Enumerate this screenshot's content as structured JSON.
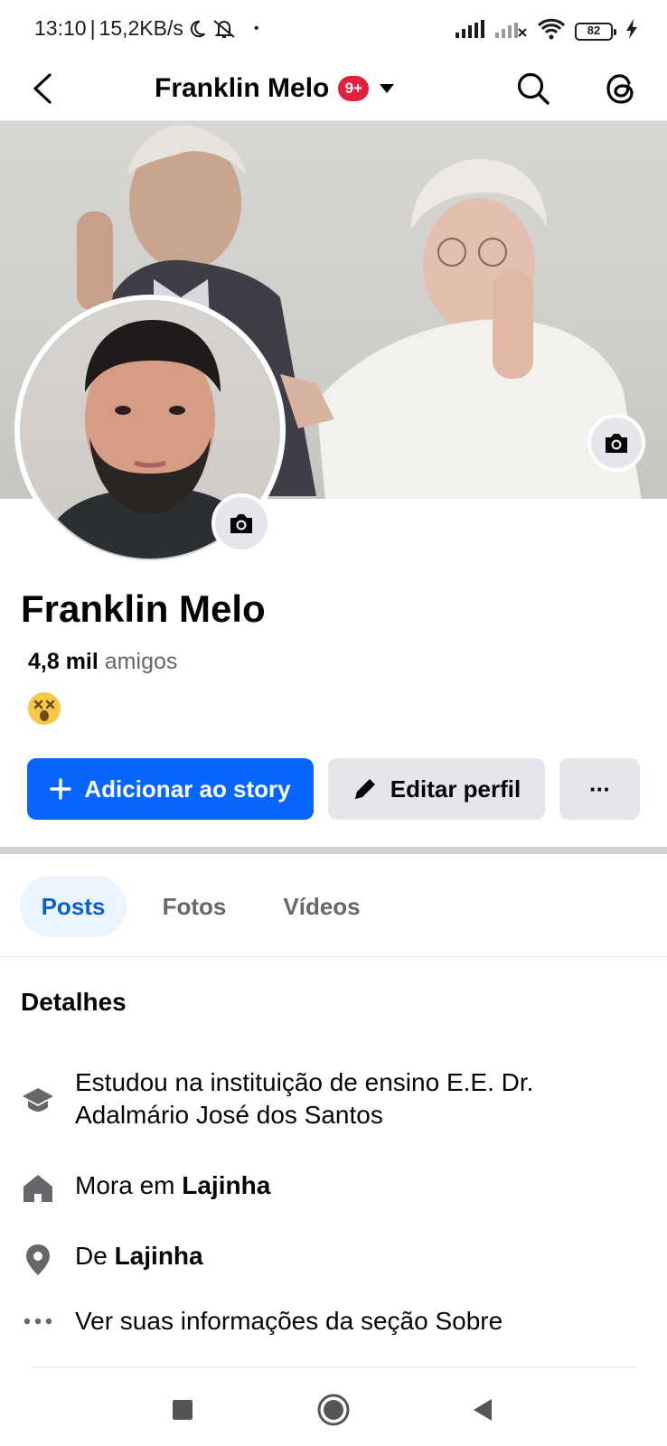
{
  "status_bar": {
    "time": "13:10",
    "separator": "|",
    "speed": "15,2KB/s",
    "battery": "82",
    "dot": "•"
  },
  "header": {
    "title": "Franklin Melo",
    "badge": "9+"
  },
  "profile": {
    "name": "Franklin Melo",
    "friends_count": "4,8 mil",
    "friends_label": "amigos"
  },
  "actions": {
    "add_story": "Adicionar ao story",
    "edit_profile": "Editar perfil",
    "more": "···"
  },
  "tabs": [
    {
      "label": "Posts",
      "selected": true
    },
    {
      "label": "Fotos",
      "selected": false
    },
    {
      "label": "Vídeos",
      "selected": false
    }
  ],
  "details": {
    "title": "Detalhes",
    "education_line1": "Estudou na instituição de ensino E.E. Dr.",
    "education_line2": "Adalmário José dos Santos",
    "lives_prefix": "Mora em ",
    "lives_place": "Lajinha",
    "from_prefix": "De ",
    "from_place": "Lajinha",
    "about_link": "Ver suas informações da seção Sobre"
  },
  "colors": {
    "primary": "#0866ff",
    "badge": "#e41e3f",
    "tab_selected_bg": "#ebf5ff",
    "secondary_button": "#e4e6eb"
  },
  "icons": {
    "back": "chevron-left-icon",
    "search": "search-icon",
    "threads": "threads-icon",
    "camera": "camera-icon",
    "plus": "plus-icon",
    "pencil": "pencil-icon",
    "education": "graduation-cap-icon",
    "home": "home-icon",
    "location": "location-pin-icon",
    "more": "more-dots-icon"
  }
}
